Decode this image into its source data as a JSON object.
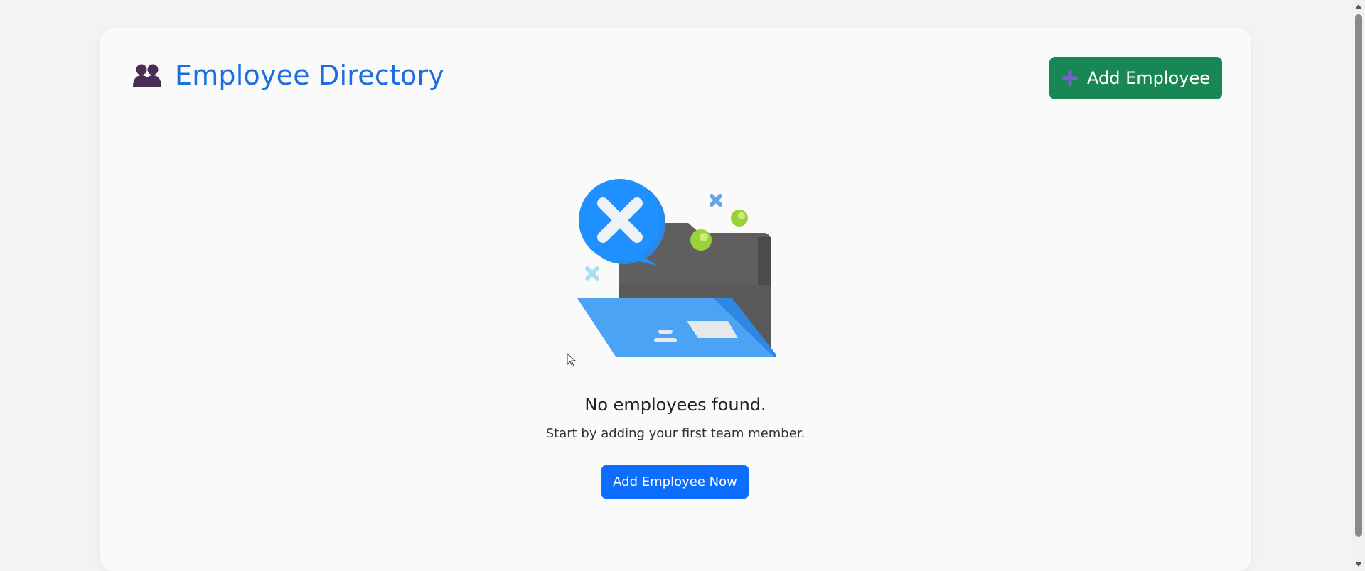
{
  "header": {
    "title": "Employee Directory",
    "title_icon": "people-icon",
    "add_button_label": "Add Employee",
    "add_button_icon": "plus-icon"
  },
  "empty_state": {
    "illustration": "empty-folder-illustration",
    "title": "No employees found.",
    "subtitle": "Start by adding your first team member.",
    "cta_label": "Add Employee Now"
  },
  "colors": {
    "title": "#1a6ee0",
    "add_button_bg": "#198754",
    "cta_bg": "#0d6efd",
    "people_icon": "#4a2d57",
    "plus_icon": "#7c5cd6"
  }
}
